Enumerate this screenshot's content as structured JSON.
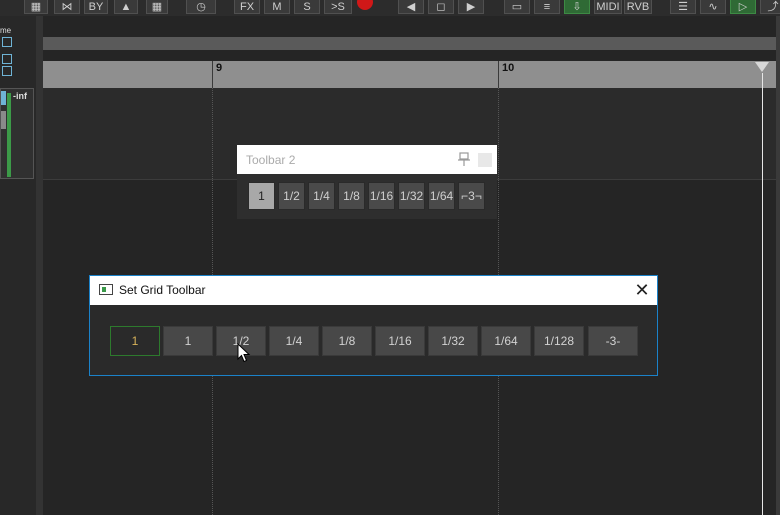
{
  "top_toolbar": {
    "fx_label": "FX",
    "mute_label": "M",
    "solo_label": "S",
    "midi_label": "MIDI",
    "rvb_label": "RVB",
    "by_label": "BY"
  },
  "left_panel": {
    "track_volume": "-inf",
    "name_label": "me"
  },
  "ruler": {
    "markers": [
      "9",
      "10"
    ]
  },
  "toolbar2": {
    "title": "Toolbar 2",
    "buttons": [
      "1",
      "1/2",
      "1/4",
      "1/8",
      "1/16",
      "1/32",
      "1/64",
      "⌐3¬"
    ],
    "active_index": 0
  },
  "set_grid_dialog": {
    "title": "Set Grid Toolbar",
    "buttons": [
      "1",
      "1",
      "1/2",
      "1/4",
      "1/8",
      "1/16",
      "1/32",
      "1/64",
      "1/128",
      "-3-"
    ],
    "selected_index": 0
  },
  "colors": {
    "accent": "#1b82c9",
    "record": "#d01818",
    "selected_text": "#d8b35a",
    "meter": "#3c9a48"
  }
}
